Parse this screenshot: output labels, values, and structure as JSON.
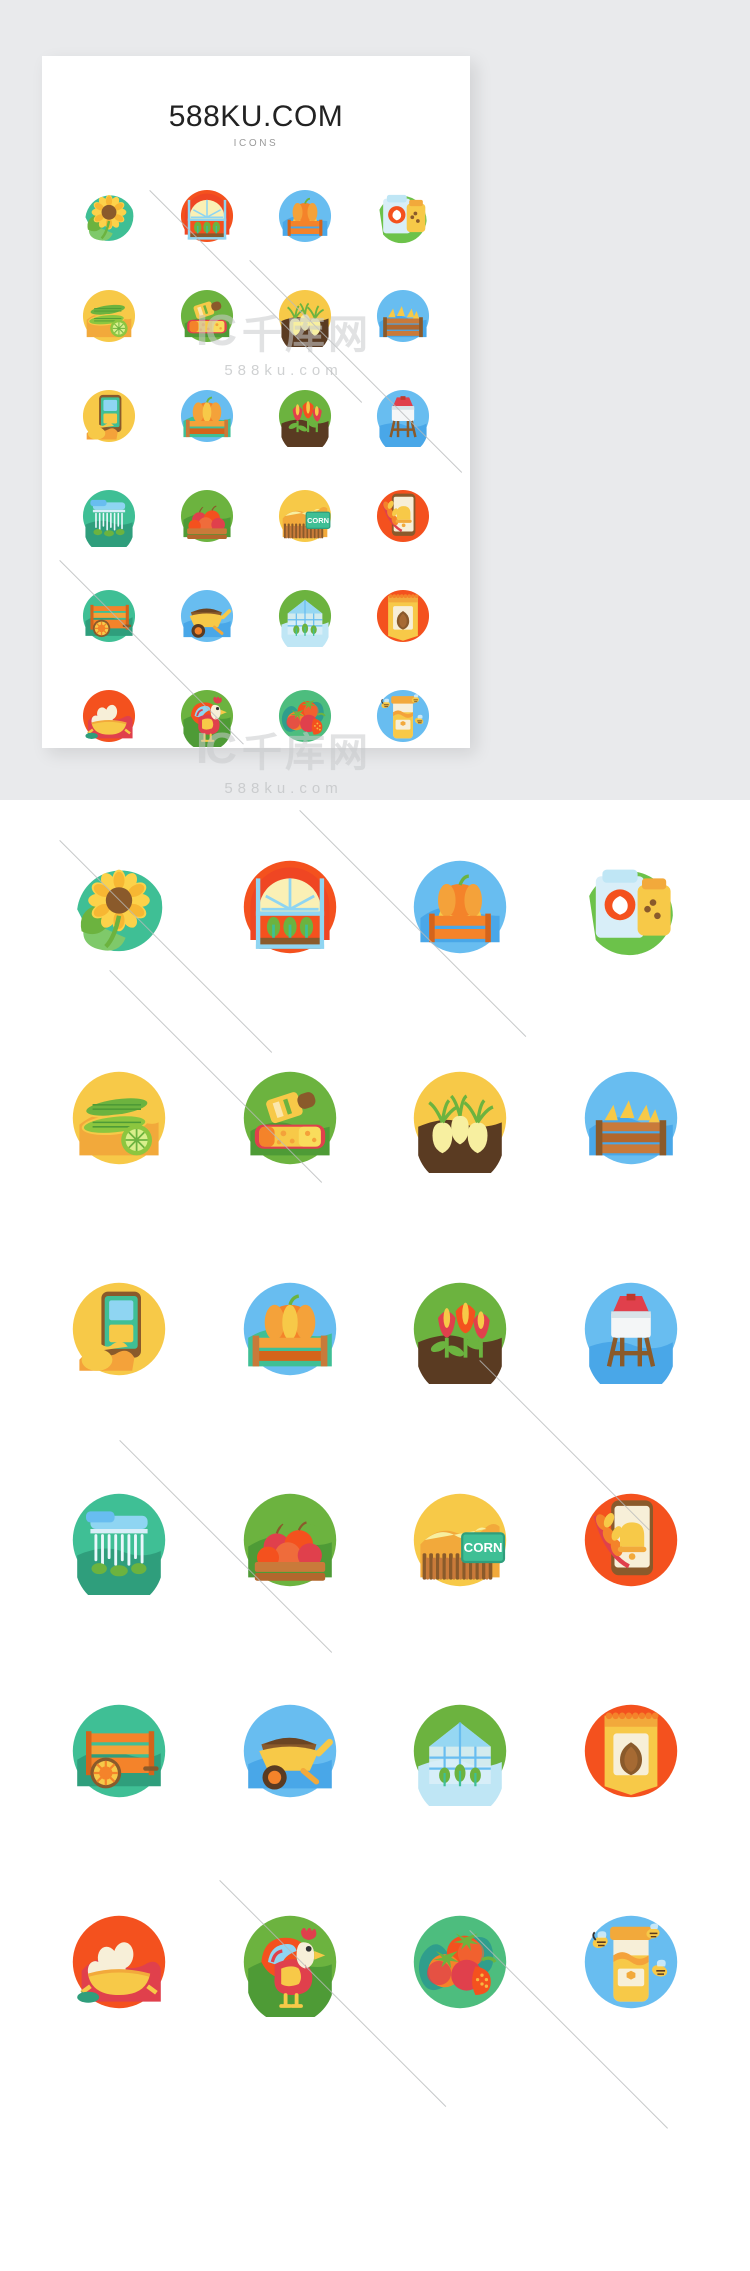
{
  "card": {
    "title": "588KU.COM",
    "subtitle": "ICONS"
  },
  "watermark": {
    "logo_mark": "IC",
    "logo_cn": "千库网",
    "url": "588ku.com"
  },
  "icons": [
    {
      "id": "sunflower",
      "name": "sunflower-icon",
      "bg": "#3fbf95",
      "blob": "#5ec98e"
    },
    {
      "id": "greenhouse",
      "name": "greenhouse-icon",
      "bg": "#f4511e",
      "blob": "#e0404c"
    },
    {
      "id": "pumpkin-cart",
      "name": "pumpkin-cart-icon",
      "bg": "#68bdf0",
      "blob": "#49a7e8"
    },
    {
      "id": "seed-bag",
      "name": "seed-bag-icon",
      "bg": "#6cc24a",
      "blob": "#bfe6f5"
    },
    {
      "id": "corn-cobs",
      "name": "corn-cobs-icon",
      "bg": "#f7c948",
      "blob": "#f2a93b"
    },
    {
      "id": "cheese-wine",
      "name": "cheese-and-wine-icon",
      "bg": "#6cb33f",
      "blob": "#4e9b36"
    },
    {
      "id": "turnips",
      "name": "turnip-harvest-icon",
      "bg": "#f7c948",
      "blob": "#5a3b22"
    },
    {
      "id": "hay-wagon",
      "name": "hay-wagon-icon",
      "bg": "#68bdf0",
      "blob": "#4aa5e4"
    },
    {
      "id": "farm-app",
      "name": "farming-app-icon",
      "bg": "#f7c948",
      "blob": "#f2a93b"
    },
    {
      "id": "pumpkin-crate",
      "name": "pumpkin-crate-icon",
      "bg": "#68bdf0",
      "blob": "#3fbf95"
    },
    {
      "id": "tulips",
      "name": "tulip-field-icon",
      "bg": "#6cb33f",
      "blob": "#5a3b22"
    },
    {
      "id": "water-tower",
      "name": "water-tower-icon",
      "bg": "#68bdf0",
      "blob": "#49a7e8"
    },
    {
      "id": "irrigation",
      "name": "irrigation-icon",
      "bg": "#3fbf95",
      "blob": "#2f9e7c"
    },
    {
      "id": "apple-crate",
      "name": "apple-crate-icon",
      "bg": "#6cb33f",
      "blob": "#4e9b36"
    },
    {
      "id": "corn-field",
      "name": "corn-field-sign-icon",
      "bg": "#f7c948",
      "blob": "#f2a93b"
    },
    {
      "id": "wheat-phone",
      "name": "wheat-phone-icon",
      "bg": "#f4511e",
      "blob": "#e0404c"
    },
    {
      "id": "orange-cart",
      "name": "orange-cart-icon",
      "bg": "#3fbf95",
      "blob": "#2f9e7c"
    },
    {
      "id": "wheelbarrow",
      "name": "wheelbarrow-icon",
      "bg": "#68bdf0",
      "blob": "#49a7e8"
    },
    {
      "id": "greenhouse-2",
      "name": "glass-greenhouse-icon",
      "bg": "#6cb33f",
      "blob": "#bfe6f5"
    },
    {
      "id": "seed-packet",
      "name": "seed-packet-icon",
      "bg": "#f4511e",
      "blob": "#e0404c"
    },
    {
      "id": "eggs-basket",
      "name": "eggs-basket-icon",
      "bg": "#f4511e",
      "blob": "#e0404c"
    },
    {
      "id": "rooster",
      "name": "rooster-icon",
      "bg": "#6cb33f",
      "blob": "#4e9b36"
    },
    {
      "id": "tomatoes",
      "name": "tomatoes-icon",
      "bg": "#4dbd7e",
      "blob": "#2f9e8c"
    },
    {
      "id": "honey-jar",
      "name": "honey-jar-bees-icon",
      "bg": "#68bdf0",
      "blob": "#49a7e8"
    }
  ],
  "labels": {
    "corn_sign": "CORN"
  },
  "colors": {
    "page_bg": "#e9eaec",
    "card_bg": "#ffffff",
    "title": "#222222",
    "subtitle": "#9a9a9a",
    "watermark": "#c9cbcd"
  }
}
